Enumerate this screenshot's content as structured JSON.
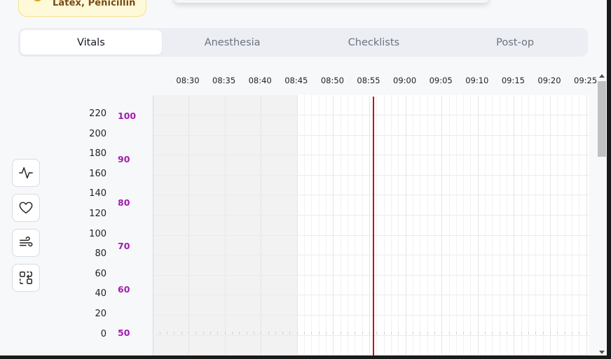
{
  "allergy": {
    "text": "Latex, Penicillin",
    "icon": "alert-circle-icon",
    "color": "#d9a21b"
  },
  "tabs": [
    {
      "label": "Vitals",
      "active": true
    },
    {
      "label": "Anesthesia",
      "active": false
    },
    {
      "label": "Checklists",
      "active": false
    },
    {
      "label": "Post-op",
      "active": false
    }
  ],
  "timeline": {
    "times": [
      "08:30",
      "08:35",
      "08:40",
      "08:45",
      "08:50",
      "08:55",
      "09:00",
      "09:05",
      "09:10",
      "09:15",
      "09:20",
      "09:25"
    ],
    "shaded_until": "08:45",
    "current_time_marker": "08:55",
    "marker_color": "#c1121f"
  },
  "y_axis_left": [
    "220",
    "200",
    "180",
    "160",
    "140",
    "120",
    "100",
    "80",
    "60",
    "40",
    "20",
    "0"
  ],
  "y_axis_right": {
    "labels": [
      "100",
      "90",
      "80",
      "70",
      "60",
      "50"
    ],
    "color": "#a21caf"
  },
  "side_tools": [
    {
      "icon": "activity-pulse-icon"
    },
    {
      "icon": "heart-icon"
    },
    {
      "icon": "wind-icon"
    },
    {
      "icon": "scan-swap-icon"
    }
  ]
}
